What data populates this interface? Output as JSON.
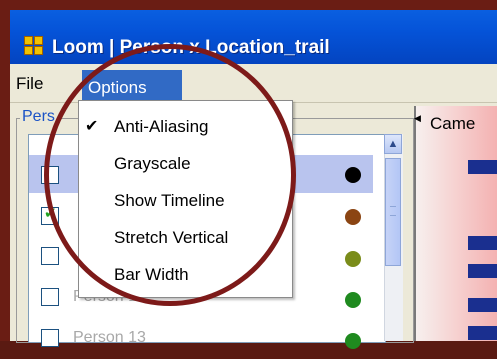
{
  "window": {
    "title": "Loom | Person x Location_trail",
    "icon": "loom-app-icon"
  },
  "menubar": {
    "file_label": "File",
    "options_label": "Options"
  },
  "options_menu": {
    "items": [
      {
        "label": "Anti-Aliasing",
        "checked": true
      },
      {
        "label": "Grayscale",
        "checked": false
      },
      {
        "label": "Show Timeline",
        "checked": false
      },
      {
        "label": "Stretch Vertical",
        "checked": false
      },
      {
        "label": "Bar Width",
        "checked": false
      }
    ],
    "check_glyph": "✔"
  },
  "left_panel": {
    "group_title": "Pers",
    "rows": [
      {
        "label": "",
        "checked": false,
        "selected": true,
        "dot_color": "#000000"
      },
      {
        "label": "",
        "checked": true,
        "selected": false,
        "dot_color": "#8b4513"
      },
      {
        "label": "",
        "checked": false,
        "selected": false,
        "dot_color": "#7a8c1a"
      },
      {
        "label": "Person 12",
        "checked": false,
        "selected": false,
        "dot_color": "#1f8a1f"
      },
      {
        "label": "Person 13",
        "checked": false,
        "selected": false,
        "dot_color": "#1f8a1f"
      }
    ]
  },
  "right_panel": {
    "title": "Came"
  },
  "colors": {
    "titlebar": "#0553d8",
    "menu_highlight": "#316ac5",
    "annotation_ring": "#7d1a19",
    "group_title": "#1b53c6"
  }
}
